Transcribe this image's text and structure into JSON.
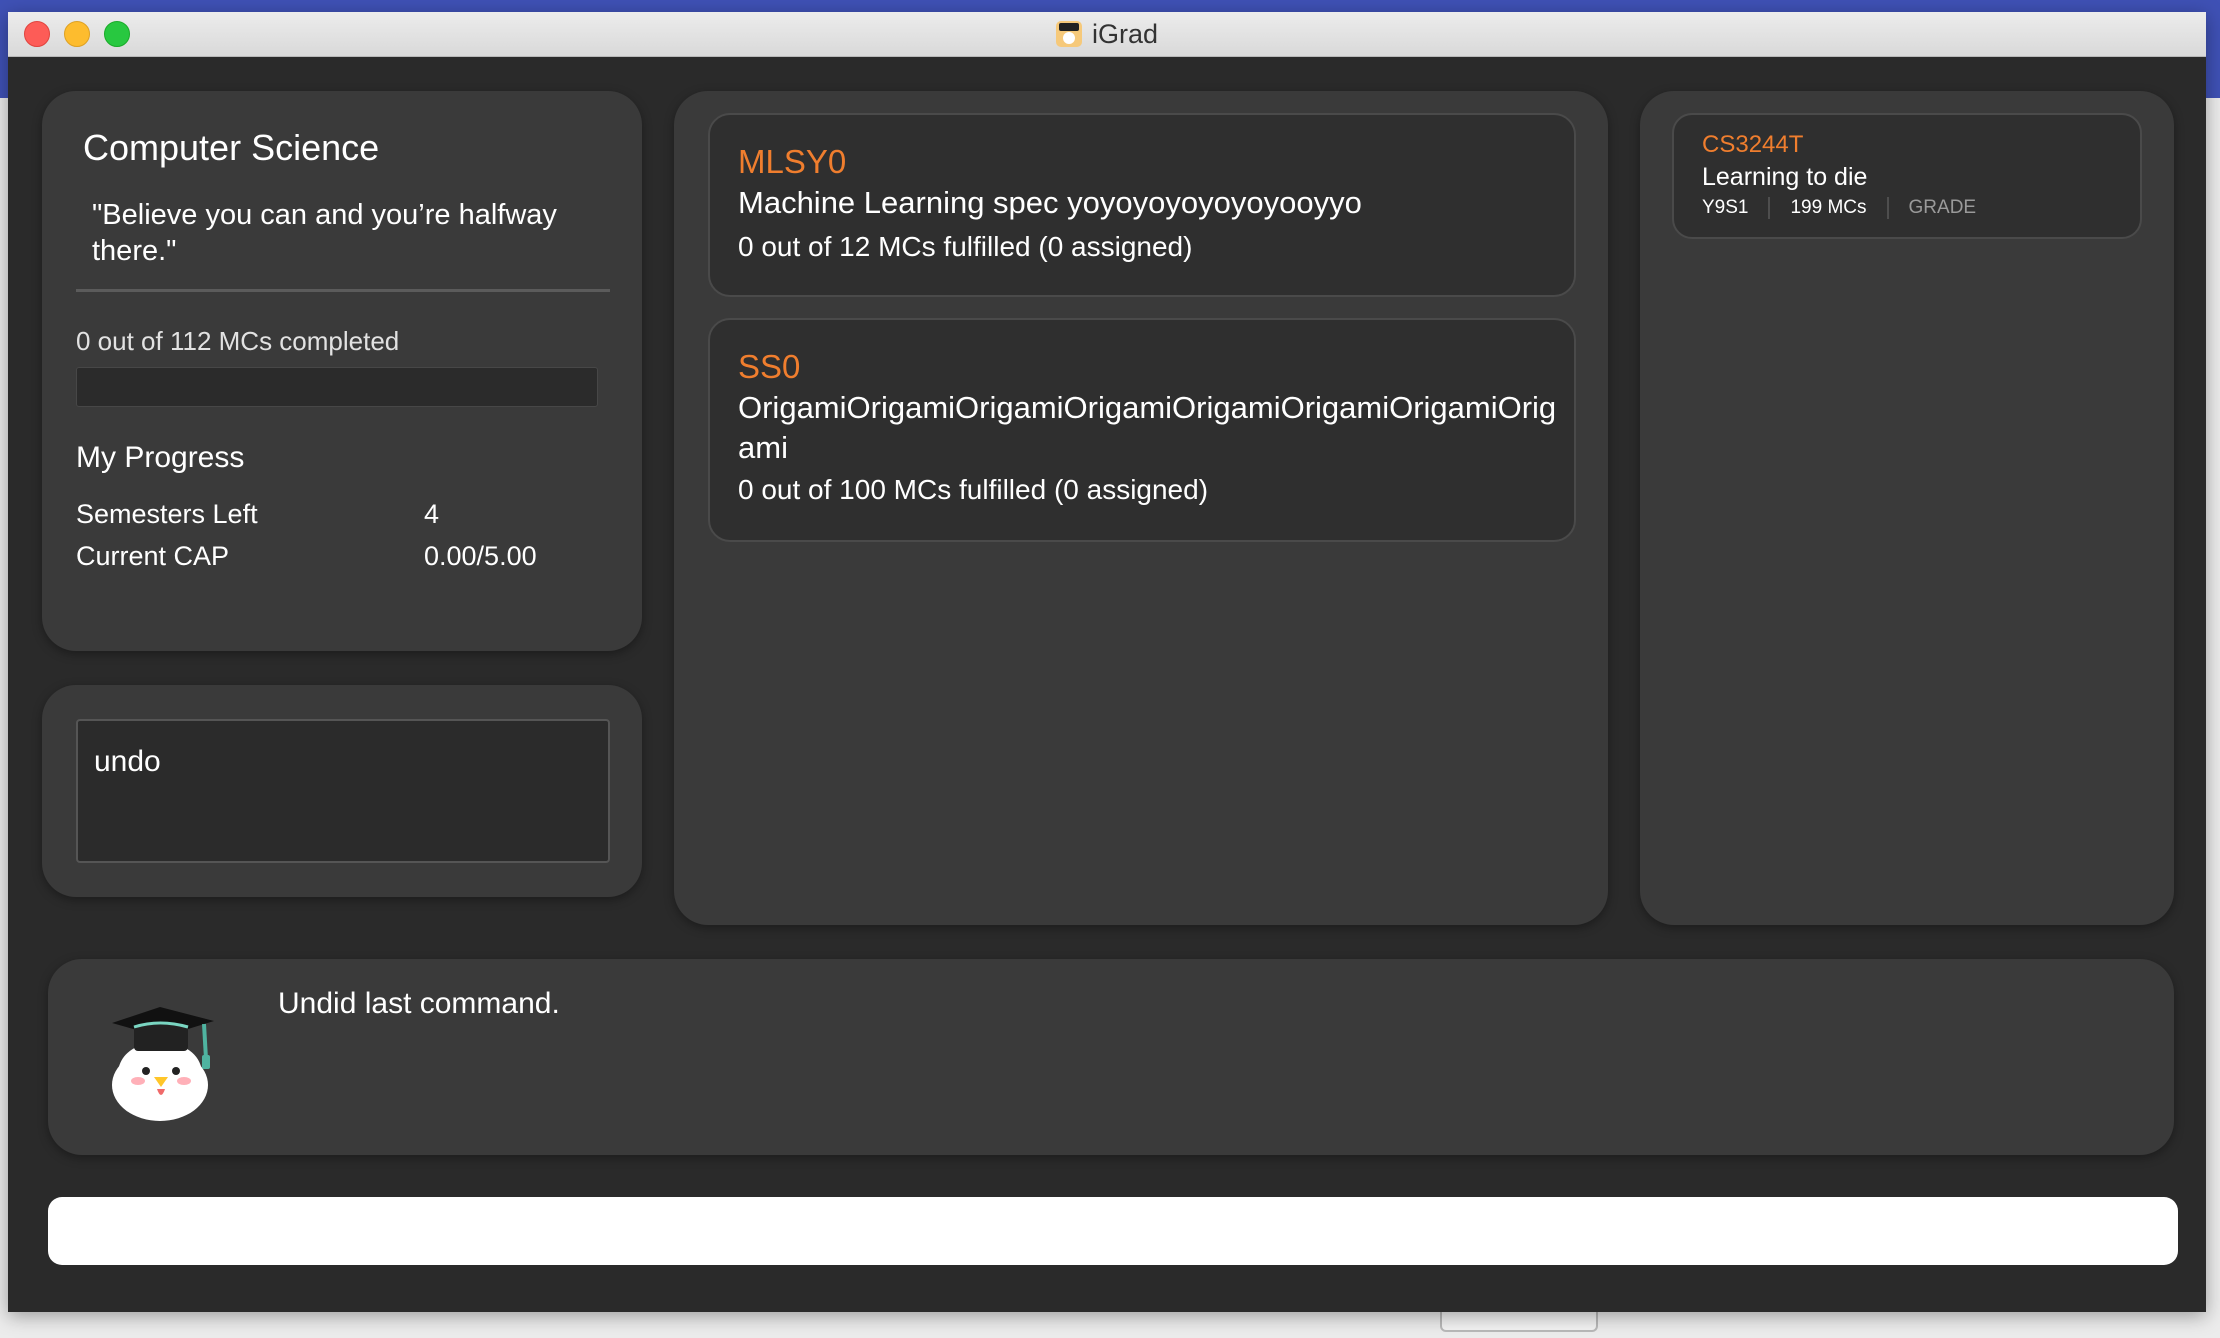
{
  "window": {
    "title": "iGrad"
  },
  "profile": {
    "course_name": "Computer Science",
    "quote": "\"Believe you can and you’re halfway there.\"",
    "mcs_completed_text": "0 out of 112 MCs completed",
    "progress_fraction": 0,
    "my_progress_heading": "My Progress",
    "stats": [
      {
        "label": "Semesters Left",
        "value": "4"
      },
      {
        "label": "Current CAP",
        "value": "0.00/5.00"
      }
    ]
  },
  "command_box": {
    "text": "undo"
  },
  "requirements": [
    {
      "code": "MLSY0",
      "title": "Machine Learning spec yoyoyoyoyoyoyooyyo",
      "mcs_text": "0 out of 12 MCs fulfilled (0 assigned)"
    },
    {
      "code": "SS0",
      "title": "OrigamiOrigamiOrigamiOrigamiOrigamiOrigamiOrigamiOrigami",
      "mcs_text": "0 out of 100 MCs fulfilled (0 assigned)"
    }
  ],
  "modules": [
    {
      "code": "CS3244T",
      "title": "Learning to die",
      "semester": "Y9S1",
      "mcs": "199 MCs",
      "grade": "GRADE"
    }
  ],
  "result": {
    "message": "Undid last command."
  },
  "command_input": {
    "value": ""
  },
  "colors": {
    "accent": "#f07e2e",
    "panel": "#3a3a3a",
    "background": "#2a2a2a"
  }
}
